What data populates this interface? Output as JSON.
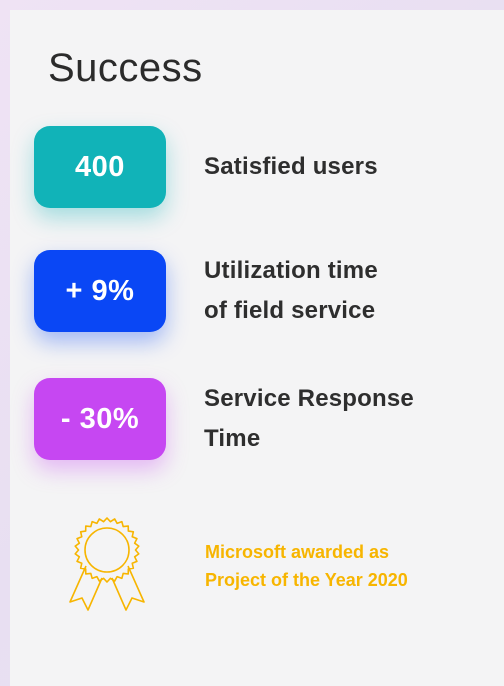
{
  "title": "Success",
  "stats": [
    {
      "value": "400",
      "label_line1": "Satisfied users",
      "label_line2": "",
      "color": "#11b3b8"
    },
    {
      "value": "+ 9%",
      "label_line1": "Utilization time",
      "label_line2": "of field service",
      "color": "#0a47f5"
    },
    {
      "value": "- 30%",
      "label_line1": "Service Response",
      "label_line2": "Time",
      "color": "#c647f2"
    }
  ],
  "award": {
    "icon": "award-ribbon-icon",
    "line1": "Microsoft awarded as",
    "line2": "Project of the Year 2020",
    "color": "#f7b500"
  }
}
